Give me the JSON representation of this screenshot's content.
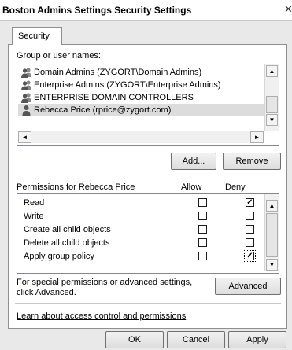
{
  "window": {
    "title": "Boston Admins Settings Security Settings",
    "close_glyph": "✕"
  },
  "tabs": [
    {
      "label": "Security",
      "selected": true
    }
  ],
  "group_list": {
    "heading": "Group or user names:",
    "items": [
      {
        "label": "Domain Admins (ZYGORT\\Domain Admins)",
        "icon": "group-icon",
        "selected": false
      },
      {
        "label": "Enterprise Admins (ZYGORT\\Enterprise Admins)",
        "icon": "group-icon",
        "selected": false
      },
      {
        "label": "ENTERPRISE DOMAIN CONTROLLERS",
        "icon": "group-icon",
        "selected": false
      },
      {
        "label": "Rebecca Price (rprice@zygort.com)",
        "icon": "person-icon",
        "selected": true
      }
    ]
  },
  "buttons": {
    "add": "Add...",
    "remove": "Remove",
    "advanced": "Advanced",
    "ok": "OK",
    "cancel": "Cancel",
    "apply": "Apply"
  },
  "permissions": {
    "heading": "Permissions for Rebecca Price",
    "allow_header": "Allow",
    "deny_header": "Deny",
    "rows": [
      {
        "name": "Read",
        "allow": false,
        "deny": true
      },
      {
        "name": "Write",
        "allow": false,
        "deny": false
      },
      {
        "name": "Create all child objects",
        "allow": false,
        "deny": false
      },
      {
        "name": "Delete all child objects",
        "allow": false,
        "deny": false
      },
      {
        "name": "Apply group policy",
        "allow": false,
        "deny": true
      }
    ]
  },
  "special": {
    "text_line1": "For special permissions or advanced settings,",
    "text_line2": "click Advanced."
  },
  "learn_link": "Learn about access control and permissions",
  "scroll_glyphs": {
    "up": "▲",
    "down": "▼",
    "left": "◄",
    "right": "►"
  },
  "check_glyph": "✓"
}
